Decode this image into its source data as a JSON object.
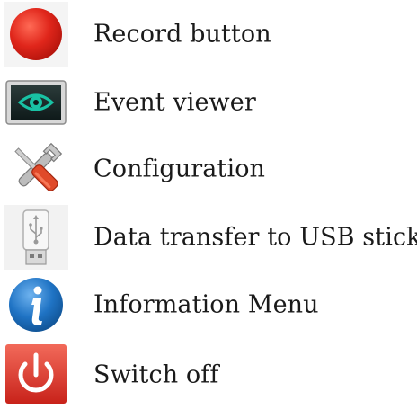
{
  "items": [
    {
      "label": "Record button",
      "icon": "record-icon",
      "color": "#e0261b"
    },
    {
      "label": "Event viewer",
      "icon": "eye-monitor-icon",
      "color": "#19c2a4"
    },
    {
      "label": "Configuration",
      "icon": "wrench-screwdriver-icon",
      "color": "#e04a2a"
    },
    {
      "label": "Data transfer to USB stick",
      "icon": "usb-stick-icon",
      "color": "#9a9a9a"
    },
    {
      "label": "Information Menu",
      "icon": "info-icon",
      "color": "#1f73c4"
    },
    {
      "label": "Switch off",
      "icon": "power-icon",
      "color": "#e03a2e"
    }
  ]
}
